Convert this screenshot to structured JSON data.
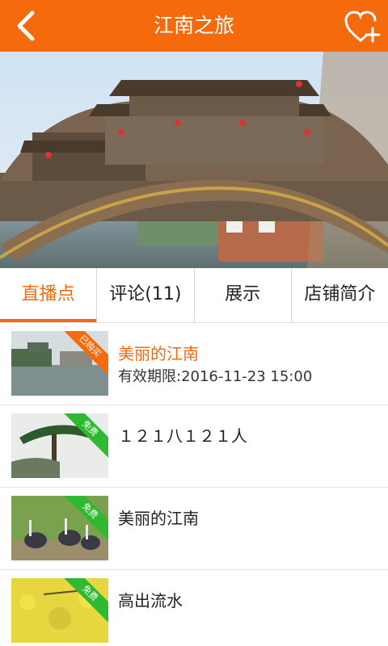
{
  "header": {
    "title": "江南之旅",
    "back_icon": "chevron-left-icon",
    "fav_icon": "heart-plus-icon"
  },
  "banner": {
    "alt": "江南廊桥风景"
  },
  "tabs": [
    {
      "label": "直播点",
      "active": true
    },
    {
      "label": "评论(11)",
      "active": false
    },
    {
      "label": "展示",
      "active": false
    },
    {
      "label": "店铺简介",
      "active": false
    }
  ],
  "items": [
    {
      "title": "美丽的江南",
      "subtitle": "有效期限:2016-11-23 15:00",
      "badge": "已购买",
      "badge_color": "#f46a0c",
      "highlight": true
    },
    {
      "title": "１２１八１２１人",
      "subtitle": "",
      "badge": "免费",
      "badge_color": "#2fb930",
      "highlight": false
    },
    {
      "title": "美丽的江南",
      "subtitle": "",
      "badge": "免费",
      "badge_color": "#2fb930",
      "highlight": false
    },
    {
      "title": "高出流水",
      "subtitle": "",
      "badge": "免费",
      "badge_color": "#2fb930",
      "highlight": false
    }
  ],
  "colors": {
    "accent": "#f46a0c",
    "free_badge": "#2fb930"
  }
}
